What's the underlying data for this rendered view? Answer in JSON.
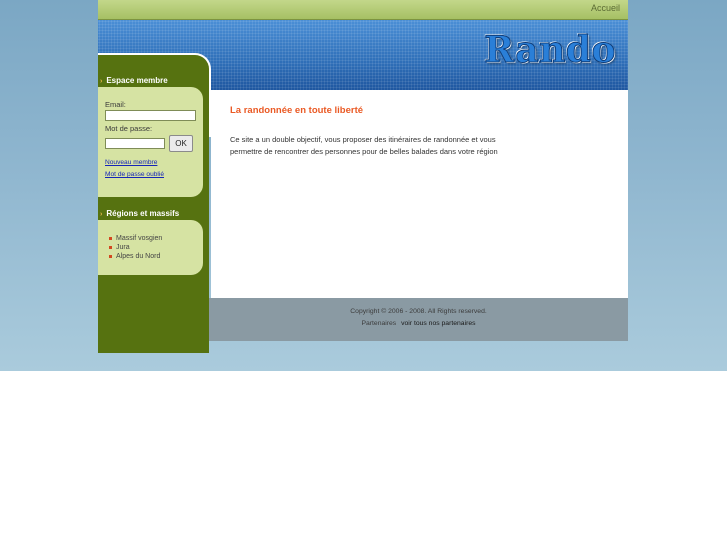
{
  "topbar": {
    "home_link": "Accueil"
  },
  "header": {
    "logo_text": "Rando"
  },
  "sidebar": {
    "member_title": "Espace membre",
    "email_label": "Email:",
    "password_label": "Mot de passe:",
    "email_value": "",
    "password_value": "",
    "ok_label": "OK",
    "new_member_link": "Nouveau membre",
    "forgot_password_link": "Mot de passe oublié",
    "regions_title": "Régions et massifs",
    "regions": [
      "Massif vosgien",
      "Jura",
      "Alpes du Nord"
    ]
  },
  "content": {
    "title": "La randonnée en toute liberté",
    "paragraph": "Ce site a un double objectif, vous proposer des itinéraires de randonnée et vous permettre de rencontrer des personnes pour de belles balades dans votre région"
  },
  "footer": {
    "copyright": "Copyright © 2006 - 2008. All Rights reserved.",
    "partners_label": "Partenaires",
    "partners_link": "voir tous nos partenaires"
  },
  "colors": {
    "topbar": "#b5cc76",
    "header_blue": "#2f6fb8",
    "sidebar_green": "#567210",
    "box_bg": "#d6e3a3",
    "title_orange": "#ea5a25",
    "footer_grey": "#8a9aa3"
  }
}
